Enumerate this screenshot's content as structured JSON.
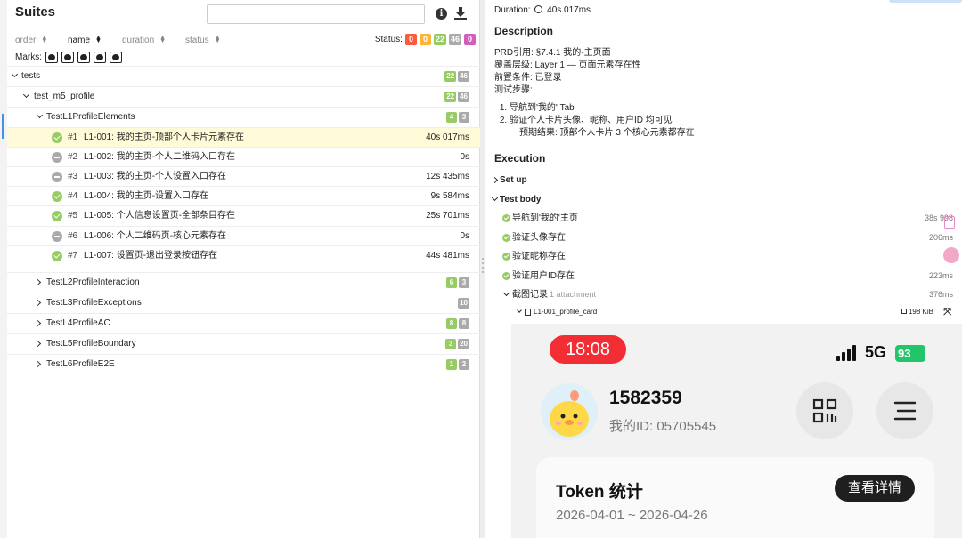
{
  "left": {
    "title": "Suites",
    "search_placeholder": "",
    "sort": {
      "order": "order",
      "name": "name",
      "duration": "duration",
      "status": "status"
    },
    "status_label": "Status:",
    "status_counts": [
      "0",
      "0",
      "22",
      "46",
      "0"
    ],
    "marks_label": "Marks:",
    "tree": {
      "root": {
        "label": "tests",
        "counts": [
          "22",
          "46"
        ]
      },
      "module": {
        "label": "test_m5_profile",
        "counts": [
          "22",
          "46"
        ]
      },
      "class1": {
        "label": "TestL1ProfileElements",
        "counts": [
          "4",
          "3"
        ]
      },
      "tests": [
        {
          "num": "#1",
          "name": "L1-001: 我的主页-顶部个人卡片元素存在",
          "duration": "40s 017ms",
          "status": "passed"
        },
        {
          "num": "#2",
          "name": "L1-002: 我的主页-个人二维码入口存在",
          "duration": "0s",
          "status": "skipped"
        },
        {
          "num": "#3",
          "name": "L1-003: 我的主页-个人设置入口存在",
          "duration": "12s 435ms",
          "status": "skipped"
        },
        {
          "num": "#4",
          "name": "L1-004: 我的主页-设置入口存在",
          "duration": "9s 584ms",
          "status": "passed"
        },
        {
          "num": "#5",
          "name": "L1-005: 个人信息设置页-全部条目存在",
          "duration": "25s 701ms",
          "status": "passed"
        },
        {
          "num": "#6",
          "name": "L1-006: 个人二维码页-核心元素存在",
          "duration": "0s",
          "status": "skipped"
        },
        {
          "num": "#7",
          "name": "L1-007: 设置页-退出登录按钮存在",
          "duration": "44s 481ms",
          "status": "passed"
        }
      ],
      "classes": [
        {
          "label": "TestL2ProfileInteraction",
          "counts": [
            "6",
            "3"
          ]
        },
        {
          "label": "TestL3ProfileExceptions",
          "counts": [
            "",
            "10"
          ]
        },
        {
          "label": "TestL4ProfileAC",
          "counts": [
            "8",
            "8"
          ]
        },
        {
          "label": "TestL5ProfileBoundary",
          "counts": [
            "3",
            "20"
          ]
        },
        {
          "label": "TestL6ProfileE2E",
          "counts": [
            "1",
            "2"
          ]
        }
      ]
    }
  },
  "right": {
    "duration_label": "Duration:",
    "duration_value": "40s 017ms",
    "description_heading": "Description",
    "desc_lines": [
      "PRD引用: §7.4.1 我的-主页面",
      "覆盖层级: Layer 1 — 页面元素存在性",
      "前置条件: 已登录",
      "测试步骤:"
    ],
    "desc_steps": [
      "导航到'我的' Tab",
      "验证个人卡片头像、昵称、用户ID 均可见"
    ],
    "desc_expected": "预期结果: 顶部个人卡片 3 个核心元素都存在",
    "execution_heading": "Execution",
    "setup_label": "Set up",
    "testbody_label": "Test body",
    "steps": [
      {
        "name": "导航到'我的'主页",
        "duration": "38s 998"
      },
      {
        "name": "验证头像存在",
        "duration": "206ms"
      },
      {
        "name": "验证昵称存在",
        "duration": "20"
      },
      {
        "name": "验证用户ID存在",
        "duration": "223ms"
      }
    ],
    "screenshot_step": {
      "name": "截图记录",
      "sub": "1 attachment",
      "duration": "376ms"
    },
    "attachment": {
      "name": "L1-001_profile_card",
      "size": "198 KiB"
    }
  },
  "phone": {
    "time": "18:08",
    "network": "5G",
    "battery": "93",
    "username": "1582359",
    "user_id": "我的ID:  05705545",
    "card_title": "Token 统计",
    "card_date": "2026-04-01 ~ 2026-04-26",
    "card_button": "查看详情"
  },
  "colors": {
    "passed": "#97cc64",
    "skipped": "#aaaaaa",
    "failed": "#fd5a3e",
    "broken": "#ffb533",
    "unknown": "#d35ebe",
    "selected_row": "#fffbd9"
  }
}
